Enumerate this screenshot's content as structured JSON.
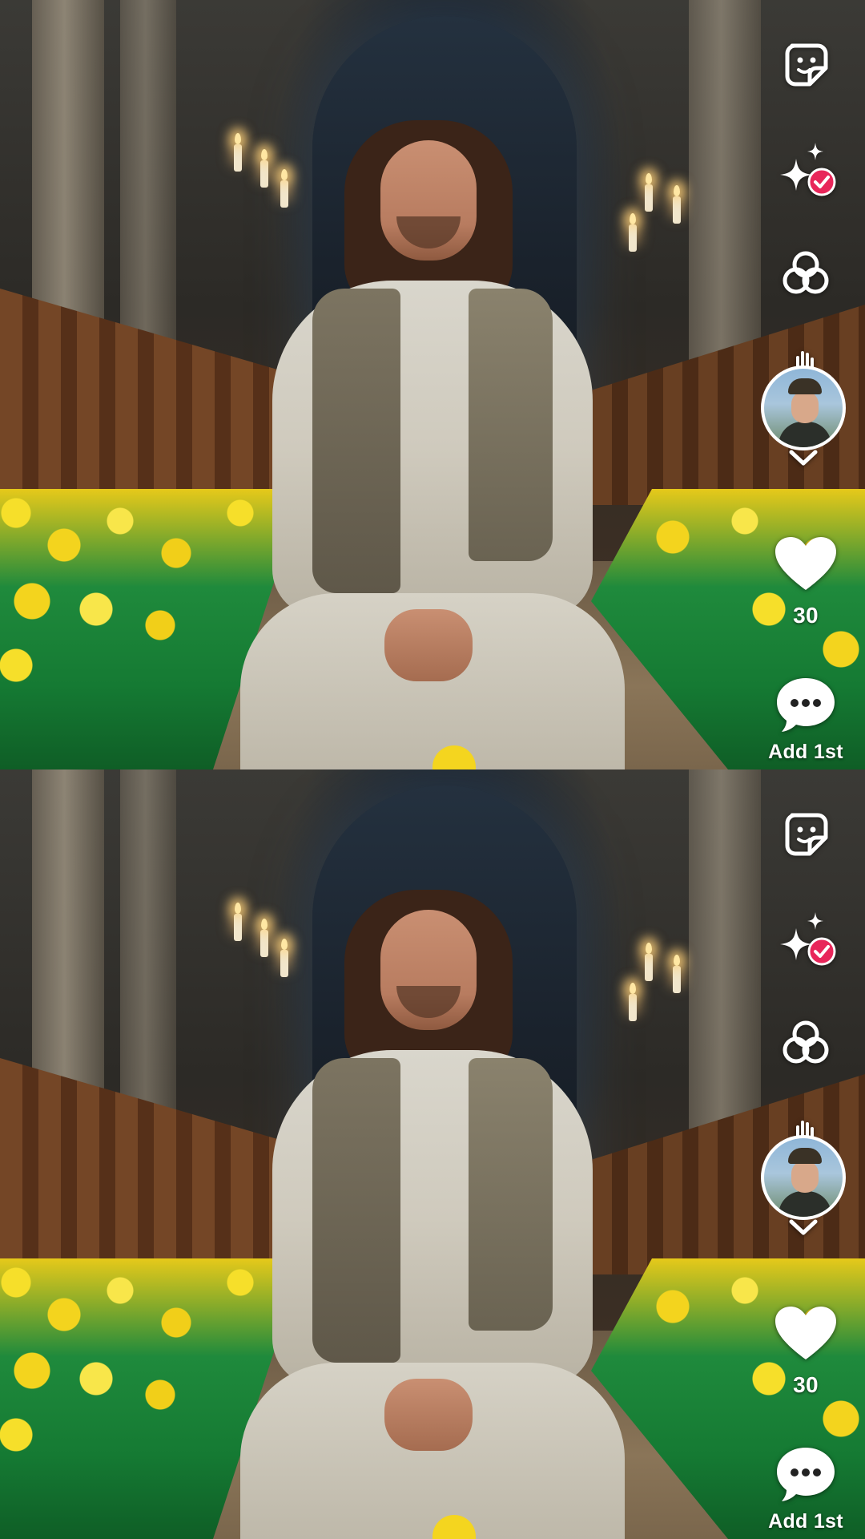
{
  "panels": [
    {
      "id": "top",
      "actions": {
        "sticker_icon": "sticker-icon",
        "ai_effects_icon": "sparkle-check-icon",
        "effects_icon": "circles-icon",
        "like_count": "30",
        "comment_label": "Add 1st"
      }
    },
    {
      "id": "bottom",
      "actions": {
        "sticker_icon": "sticker-icon",
        "ai_effects_icon": "sparkle-check-icon",
        "effects_icon": "circles-icon",
        "like_count": "30",
        "comment_label": "Add 1st"
      }
    }
  ],
  "colors": {
    "accent_badge": "#e8265a",
    "icon_white": "#ffffff"
  }
}
